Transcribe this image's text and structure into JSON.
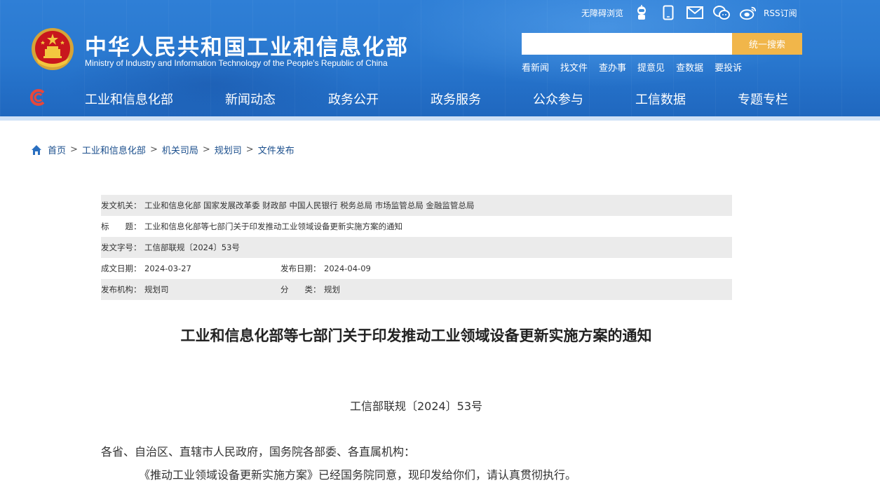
{
  "header": {
    "title_cn": "中华人民共和国工业和信息化部",
    "title_en": "Ministry of Industry and Information Technology of the People's Republic of China",
    "toolbar": {
      "accessible_label": "无障碍浏览",
      "rss_label": "RSS订阅"
    },
    "search": {
      "value": "",
      "button_label": "统一搜索"
    },
    "quick_links": [
      "看新闻",
      "找文件",
      "查办事",
      "提意见",
      "查数据",
      "要投诉"
    ],
    "nav": [
      "工业和信息化部",
      "新闻动态",
      "政务公开",
      "政务服务",
      "公众参与",
      "工信数据",
      "专题专栏"
    ]
  },
  "breadcrumb": [
    "首页",
    "工业和信息化部",
    "机关司局",
    "规划司",
    "文件发布"
  ],
  "meta": {
    "issuer_label": "发文机关：",
    "issuer": "工业和信息化部 国家发展改革委 财政部 中国人民银行 税务总局 市场监管总局 金融监管总局",
    "subject_label": "标　　题：",
    "subject": "工业和信息化部等七部门关于印发推动工业领域设备更新实施方案的通知",
    "docno_label": "发文字号：",
    "docno": "工信部联规〔2024〕53号",
    "created_label": "成文日期：",
    "created": "2024-03-27",
    "published_label": "发布日期：",
    "published": "2024-04-09",
    "org_label": "发布机构：",
    "org": "规划司",
    "category_label": "分　　类：",
    "category": "规划"
  },
  "article": {
    "title": "工业和信息化部等七部门关于印发推动工业领域设备更新实施方案的通知",
    "docno": "工信部联规〔2024〕53号",
    "recipients": "各省、自治区、直辖市人民政府，国务院各部委、各直属机构：",
    "paragraph": "《推动工业领域设备更新实施方案》已经国务院同意，现印发给你们，请认真贯彻执行。"
  },
  "colors": {
    "header_blue": "#2a79d0",
    "search_button": "#f1b64a",
    "meta_shade": "#ebebeb"
  }
}
